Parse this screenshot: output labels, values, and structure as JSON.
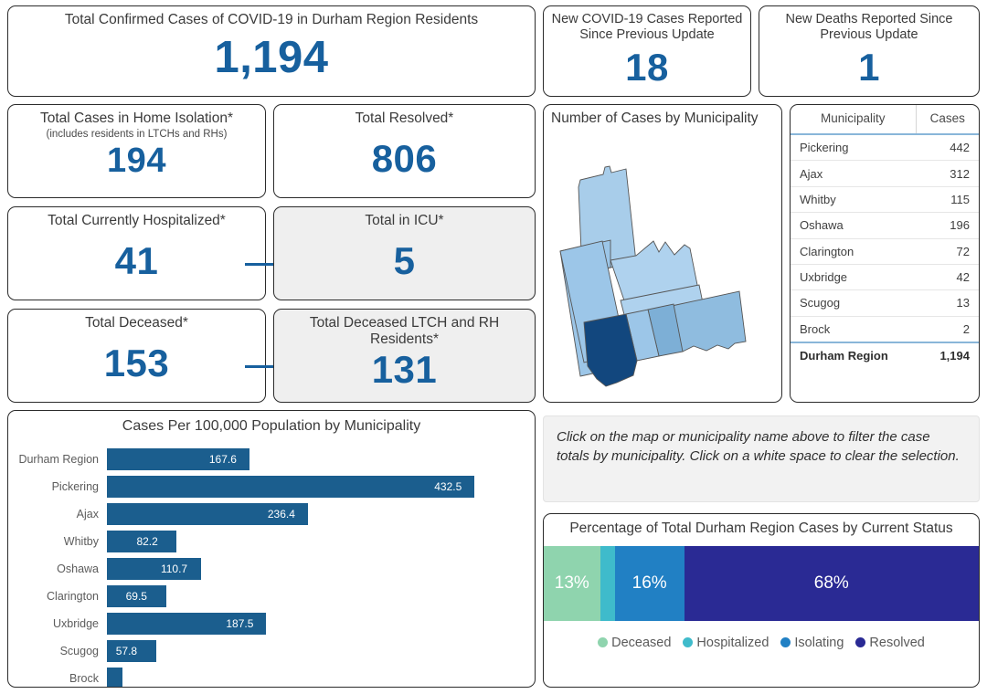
{
  "kpis": {
    "total_confirmed": {
      "title": "Total Confirmed Cases of COVID-19 in Durham Region Residents",
      "value": "1,194"
    },
    "new_cases": {
      "title": "New COVID-19 Cases Reported Since Previous Update",
      "value": "18"
    },
    "new_deaths": {
      "title": "New Deaths Reported Since Previous Update",
      "value": "1"
    },
    "home_isolation": {
      "title": "Total Cases in Home Isolation*",
      "subtitle": "(includes residents in LTCHs and RHs)",
      "value": "194"
    },
    "resolved": {
      "title": "Total Resolved*",
      "value": "806"
    },
    "hospitalized": {
      "title": "Total Currently Hospitalized*",
      "value": "41"
    },
    "icu": {
      "title": "Total in ICU*",
      "value": "5"
    },
    "deceased": {
      "title": "Total Deceased*",
      "value": "153"
    },
    "deceased_ltch": {
      "title": "Total Deceased LTCH and RH Residents*",
      "value": "131"
    }
  },
  "map": {
    "title": "Number of Cases by Municipality",
    "regions": [
      {
        "name": "Brock",
        "color": "#a8cdea"
      },
      {
        "name": "Uxbridge",
        "color": "#9cc6e8"
      },
      {
        "name": "Scugog",
        "color": "#afd2ee"
      },
      {
        "name": "Clarington",
        "color": "#8fbcdf"
      },
      {
        "name": "Pickering",
        "color": "#12477e"
      },
      {
        "name": "Ajax",
        "color": "#6fa5d2"
      },
      {
        "name": "Whitby",
        "color": "#9cc6e8"
      },
      {
        "name": "Oshawa",
        "color": "#7dafd6"
      }
    ]
  },
  "table": {
    "headers": [
      "Municipality",
      "Cases"
    ],
    "rows": [
      {
        "name": "Pickering",
        "cases": "442"
      },
      {
        "name": "Ajax",
        "cases": "312"
      },
      {
        "name": "Whitby",
        "cases": "115"
      },
      {
        "name": "Oshawa",
        "cases": "196"
      },
      {
        "name": "Clarington",
        "cases": "72"
      },
      {
        "name": "Uxbridge",
        "cases": "42"
      },
      {
        "name": "Scugog",
        "cases": "13"
      },
      {
        "name": "Brock",
        "cases": "2"
      }
    ],
    "total": {
      "name": "Durham Region",
      "cases": "1,194"
    }
  },
  "note": {
    "text": "Click on the map or municipality name above to filter the case totals by municipality. Click on a white space to clear the selection."
  },
  "chart_data": [
    {
      "type": "bar",
      "orientation": "horizontal",
      "title": "Cases Per 100,000 Population by Municipality",
      "xlabel": "",
      "ylabel": "",
      "grid": false,
      "xlim": [
        0,
        450
      ],
      "categories": [
        "Durham Region",
        "Pickering",
        "Ajax",
        "Whitby",
        "Oshawa",
        "Clarington",
        "Uxbridge",
        "Scugog",
        "Brock"
      ],
      "values": [
        167.6,
        432.5,
        236.4,
        82.2,
        110.7,
        69.5,
        187.5,
        57.8,
        18.2
      ],
      "labels": [
        "167.6",
        "432.5",
        "236.4",
        "82.2",
        "110.7",
        "69.5",
        "187.5",
        "57.8",
        ""
      ],
      "bar_color": "#1b5e8e"
    },
    {
      "type": "bar",
      "orientation": "stacked-horizontal",
      "title": "Percentage of Total Durham Region Cases by Current Status",
      "legend_position": "bottom",
      "categories": [
        "Deceased",
        "Hospitalized",
        "Isolating",
        "Resolved"
      ],
      "values": [
        13,
        3.4,
        16,
        68
      ],
      "labels": [
        "13%",
        "",
        "16%",
        "68%"
      ],
      "colors": [
        "#8fd4ae",
        "#3fbbcb",
        "#2180c4",
        "#2a2a94"
      ]
    }
  ],
  "colors": {
    "kpi_value": "#17609e",
    "bar": "#1b5e8e",
    "card_border": "#2b2b2b",
    "shaded_card": "#efefef"
  }
}
